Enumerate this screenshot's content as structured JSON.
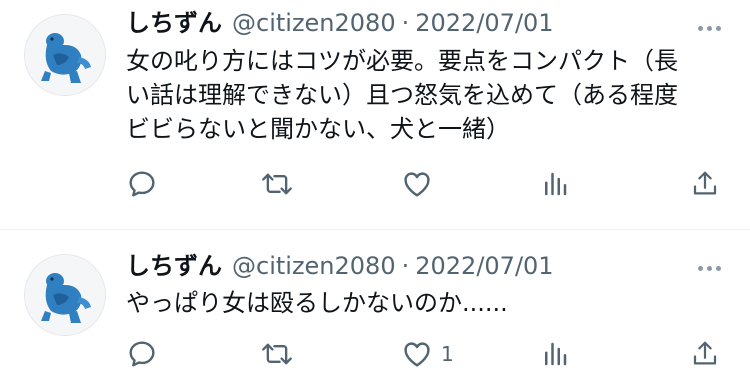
{
  "tweets": [
    {
      "display_name": "しちずん",
      "handle": "@citizen2080",
      "separator": "·",
      "date": "2022/07/01",
      "text": "女の叱り方にはコツが必要。要点をコンパクト（長\nい話は理解できない）且つ怒気を込めて（ある程度\nビビらないと聞かない、犬と一緒）",
      "like_count": "",
      "icons": [
        "reply-icon",
        "retweet-icon",
        "like-icon",
        "views-icon",
        "share-icon",
        "more-icon"
      ]
    },
    {
      "display_name": "しちずん",
      "handle": "@citizen2080",
      "separator": "·",
      "date": "2022/07/01",
      "text": "やっぱり女は殴るしかないのか......",
      "like_count": "1",
      "icons": [
        "reply-icon",
        "retweet-icon",
        "like-icon",
        "views-icon",
        "share-icon",
        "more-icon"
      ]
    }
  ],
  "colors": {
    "text_primary": "#0f1419",
    "text_secondary": "#536471",
    "icon": "#536471",
    "divider": "#eff3f4",
    "avatar_figure": "#2f7fc1"
  }
}
